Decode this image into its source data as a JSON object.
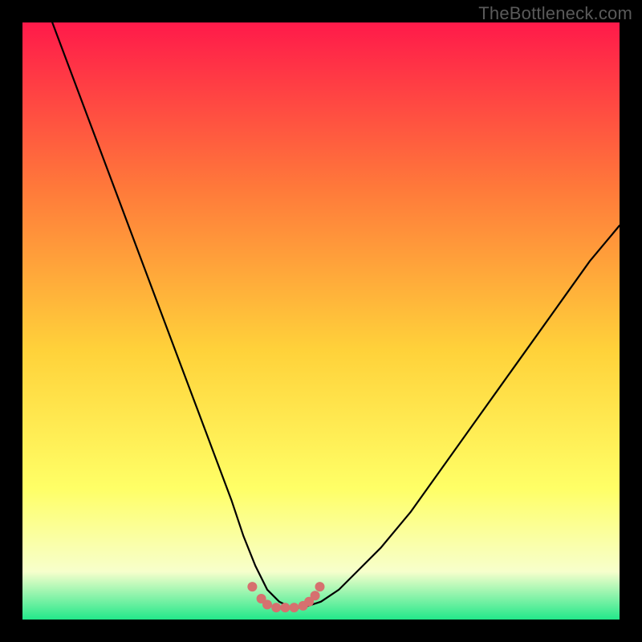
{
  "attribution": "TheBottleneck.com",
  "colors": {
    "frame": "#000000",
    "gradient_top": "#ff1a4a",
    "gradient_mid1": "#ff7a3a",
    "gradient_mid2": "#ffd23a",
    "gradient_mid3": "#ffff66",
    "gradient_mid4": "#f7ffcc",
    "gradient_bottom": "#22e88a",
    "curve": "#000000",
    "marker": "#d6706f"
  },
  "chart_data": {
    "type": "line",
    "title": "",
    "xlabel": "",
    "ylabel": "",
    "xlim": [
      0,
      100
    ],
    "ylim": [
      0,
      100
    ],
    "series": [
      {
        "name": "bottleneck-curve",
        "x": [
          5,
          8,
          11,
          14,
          17,
          20,
          23,
          26,
          29,
          32,
          35,
          37,
          39,
          41,
          43,
          45,
          47,
          50,
          53,
          56,
          60,
          65,
          70,
          75,
          80,
          85,
          90,
          95,
          100
        ],
        "y": [
          100,
          92,
          84,
          76,
          68,
          60,
          52,
          44,
          36,
          28,
          20,
          14,
          9,
          5,
          3,
          2,
          2,
          3,
          5,
          8,
          12,
          18,
          25,
          32,
          39,
          46,
          53,
          60,
          66
        ]
      }
    ],
    "markers": {
      "name": "highlight-dots",
      "x": [
        38.5,
        40,
        41,
        42.5,
        44,
        45.5,
        47,
        48,
        49,
        49.8
      ],
      "y": [
        5.5,
        3.5,
        2.5,
        2,
        2,
        2,
        2.3,
        3,
        4,
        5.5
      ]
    }
  }
}
